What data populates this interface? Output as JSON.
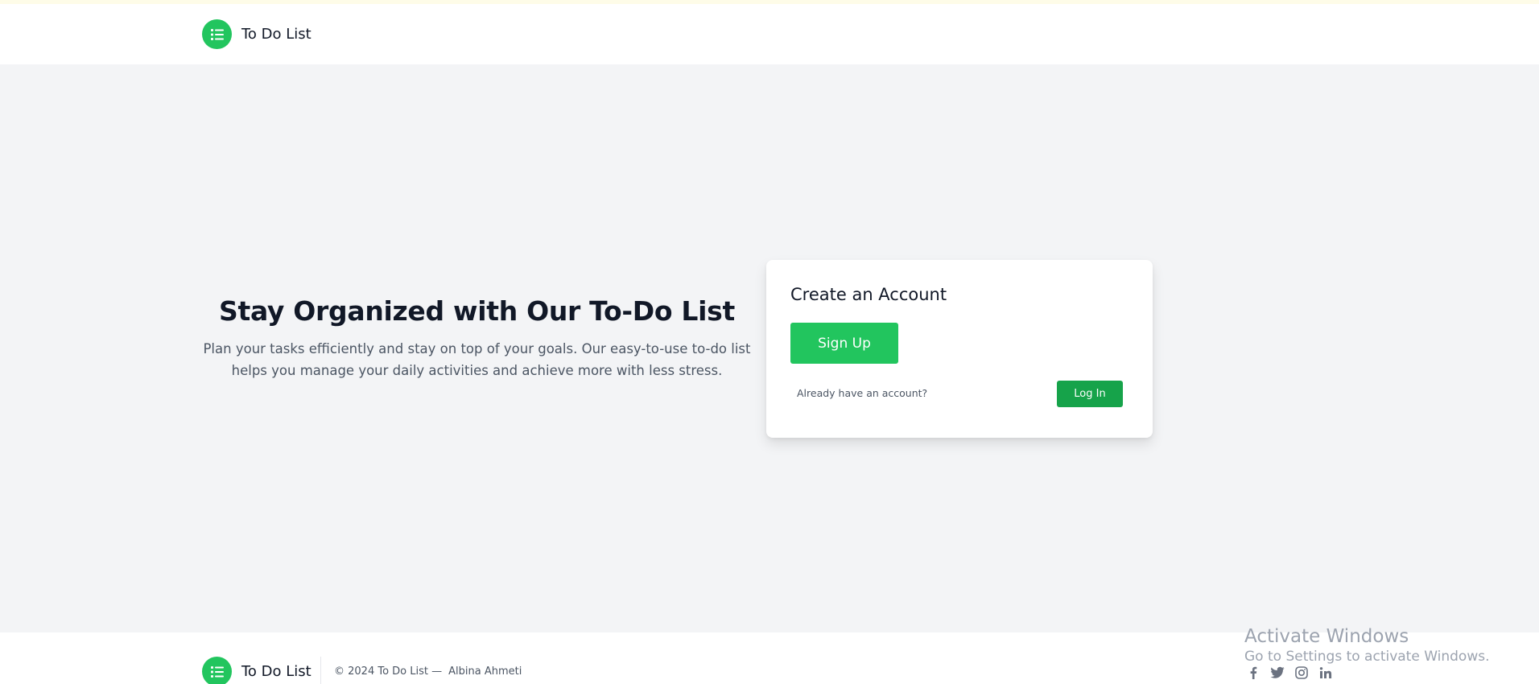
{
  "header": {
    "brand": "To Do List",
    "logo_icon": "list-icon"
  },
  "hero": {
    "title": "Stay Organized with Our To-Do List",
    "description": "Plan your tasks efficiently and stay on top of your goals. Our easy-to-use to-do list helps you manage your daily activities and achieve more with less stress."
  },
  "signup_card": {
    "title": "Create an Account",
    "signup_label": "Sign Up",
    "already_text": "Already have an account?",
    "login_label": "Log In"
  },
  "footer": {
    "brand": "To Do List",
    "copyright": "© 2024 To Do List —",
    "author": "Albina Ahmeti",
    "social_icons": [
      "facebook-icon",
      "twitter-icon",
      "instagram-icon",
      "linkedin-icon"
    ]
  },
  "watermark": {
    "line1": "Activate Windows",
    "line2": "Go to Settings to activate Windows."
  },
  "colors": {
    "accent": "#22c55e",
    "accent_dark": "#16a34a",
    "page_bg": "#f3f4f6",
    "text": "#111827",
    "muted": "#4b5563"
  }
}
